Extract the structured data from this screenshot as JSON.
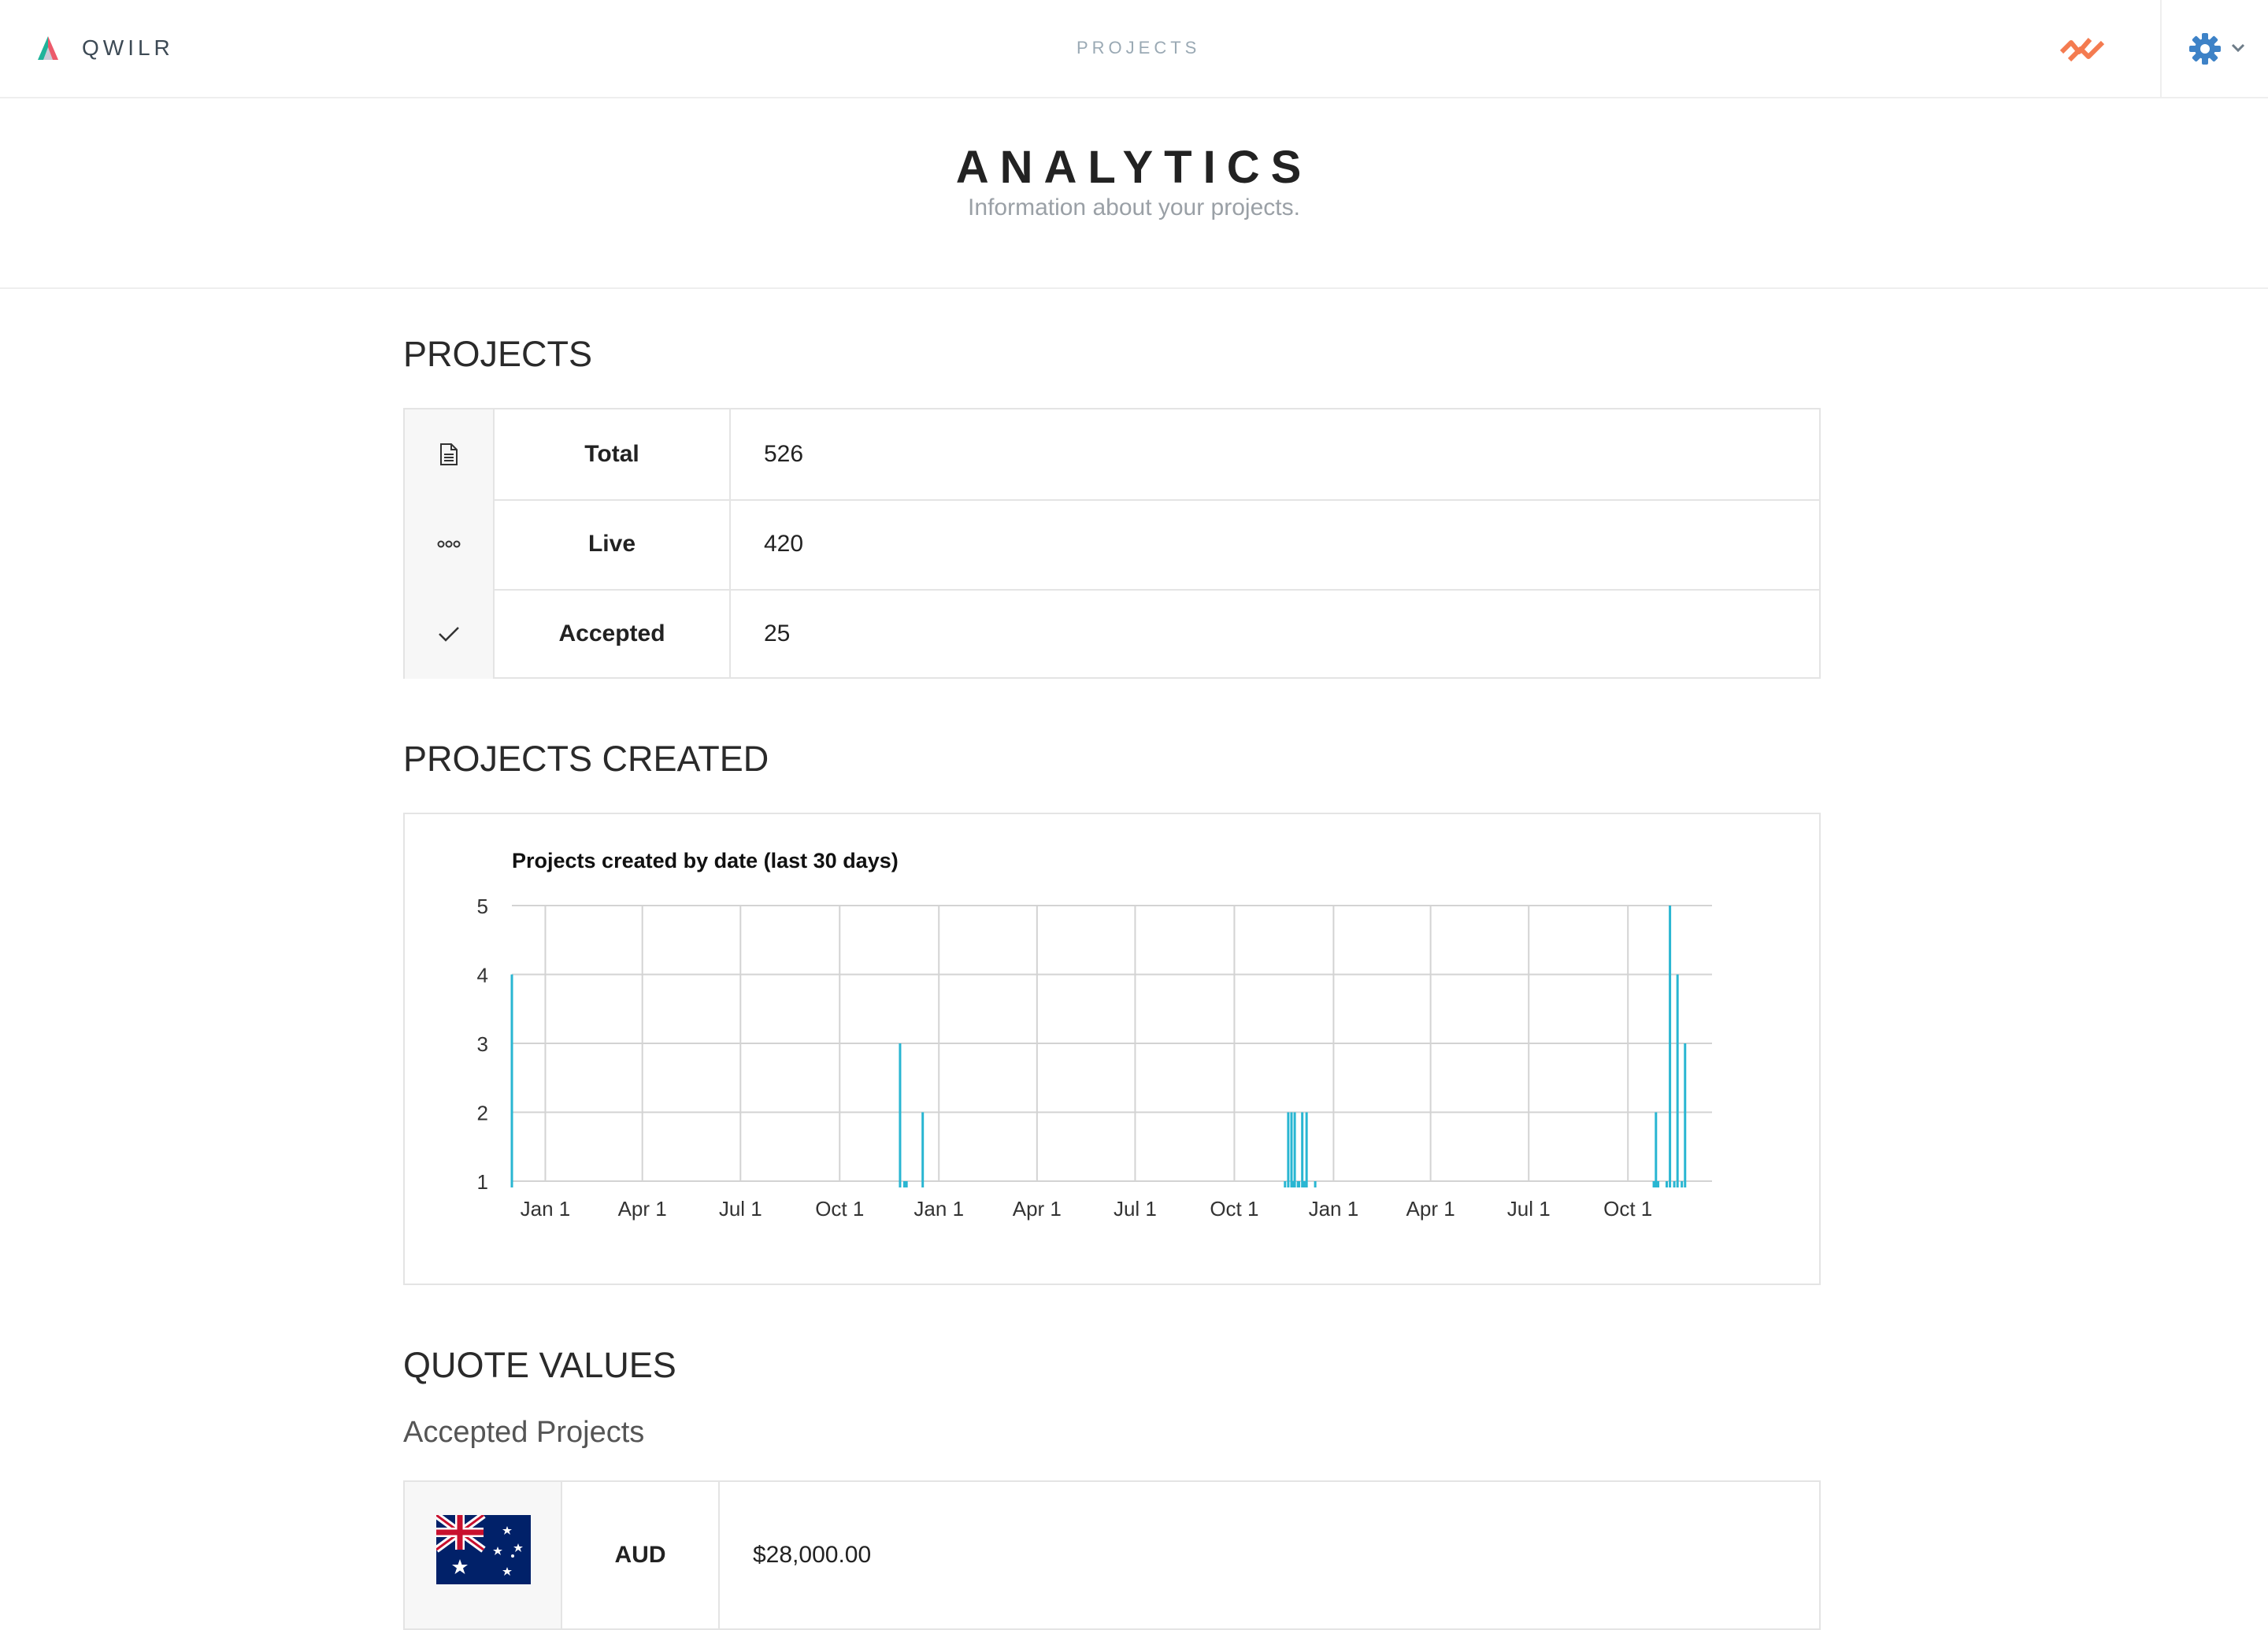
{
  "topbar": {
    "brand": "QWILR",
    "nav_projects": "PROJECTS",
    "icons": {
      "logo": "qwilr-logo",
      "activity": "activity-icon",
      "settings": "gear-icon",
      "dropdown": "chevron-down-icon"
    },
    "colors": {
      "activity": "#f47b50",
      "settings": "#3d82c7"
    }
  },
  "header": {
    "title": "ANALYTICS",
    "subtitle": "Information about your projects."
  },
  "projects": {
    "section_title": "PROJECTS",
    "rows": [
      {
        "icon": "document-icon",
        "label": "Total",
        "value": "526"
      },
      {
        "icon": "ellipsis-icon",
        "label": "Live",
        "value": "420"
      },
      {
        "icon": "check-icon",
        "label": "Accepted",
        "value": "25"
      }
    ]
  },
  "projects_created": {
    "section_title": "PROJECTS CREATED"
  },
  "chart_data": {
    "type": "bar",
    "title": "Projects created by date (last 30 days)",
    "xlabel": "",
    "ylabel": "",
    "ylim": [
      1,
      5
    ],
    "yticks": [
      "1",
      "2",
      "3",
      "4",
      "5"
    ],
    "xlim": [
      "2014-12-01",
      "2017-12-18"
    ],
    "xticks": [
      {
        "date": "2015-01-01",
        "label": "Jan 1"
      },
      {
        "date": "2015-04-01",
        "label": "Apr 1"
      },
      {
        "date": "2015-07-01",
        "label": "Jul 1"
      },
      {
        "date": "2015-10-01",
        "label": "Oct 1"
      },
      {
        "date": "2016-01-01",
        "label": "Jan 1"
      },
      {
        "date": "2016-04-01",
        "label": "Apr 1"
      },
      {
        "date": "2016-07-01",
        "label": "Jul 1"
      },
      {
        "date": "2016-10-01",
        "label": "Oct 1"
      },
      {
        "date": "2017-01-01",
        "label": "Jan 1"
      },
      {
        "date": "2017-04-01",
        "label": "Apr 1"
      },
      {
        "date": "2017-07-01",
        "label": "Jul 1"
      },
      {
        "date": "2017-10-01",
        "label": "Oct 1"
      }
    ],
    "grid": true,
    "bar_color": "#29b6d2",
    "series": [
      {
        "values": [
          {
            "x": "2014-12-01",
            "y": 4
          },
          {
            "x": "2015-11-26",
            "y": 3
          },
          {
            "x": "2015-11-30",
            "y": 1
          },
          {
            "x": "2015-12-02",
            "y": 1
          },
          {
            "x": "2015-12-17",
            "y": 2
          },
          {
            "x": "2016-11-17",
            "y": 1
          },
          {
            "x": "2016-11-20",
            "y": 2
          },
          {
            "x": "2016-11-23",
            "y": 2
          },
          {
            "x": "2016-11-25",
            "y": 1
          },
          {
            "x": "2016-11-26",
            "y": 2
          },
          {
            "x": "2016-11-29",
            "y": 1
          },
          {
            "x": "2016-11-30",
            "y": 1
          },
          {
            "x": "2016-12-03",
            "y": 2
          },
          {
            "x": "2016-12-05",
            "y": 1
          },
          {
            "x": "2016-12-07",
            "y": 2
          },
          {
            "x": "2016-12-15",
            "y": 1
          },
          {
            "x": "2017-10-25",
            "y": 1
          },
          {
            "x": "2017-10-27",
            "y": 2
          },
          {
            "x": "2017-10-29",
            "y": 1
          },
          {
            "x": "2017-11-06",
            "y": 1
          },
          {
            "x": "2017-11-09",
            "y": 5
          },
          {
            "x": "2017-11-13",
            "y": 1
          },
          {
            "x": "2017-11-16",
            "y": 4
          },
          {
            "x": "2017-11-20",
            "y": 1
          },
          {
            "x": "2017-11-23",
            "y": 3
          }
        ]
      }
    ]
  },
  "quote_values": {
    "section_title": "QUOTE VALUES",
    "subtitle": "Accepted Projects",
    "rows": [
      {
        "flag": "australia-flag",
        "currency": "AUD",
        "value": "$28,000.00"
      }
    ]
  }
}
